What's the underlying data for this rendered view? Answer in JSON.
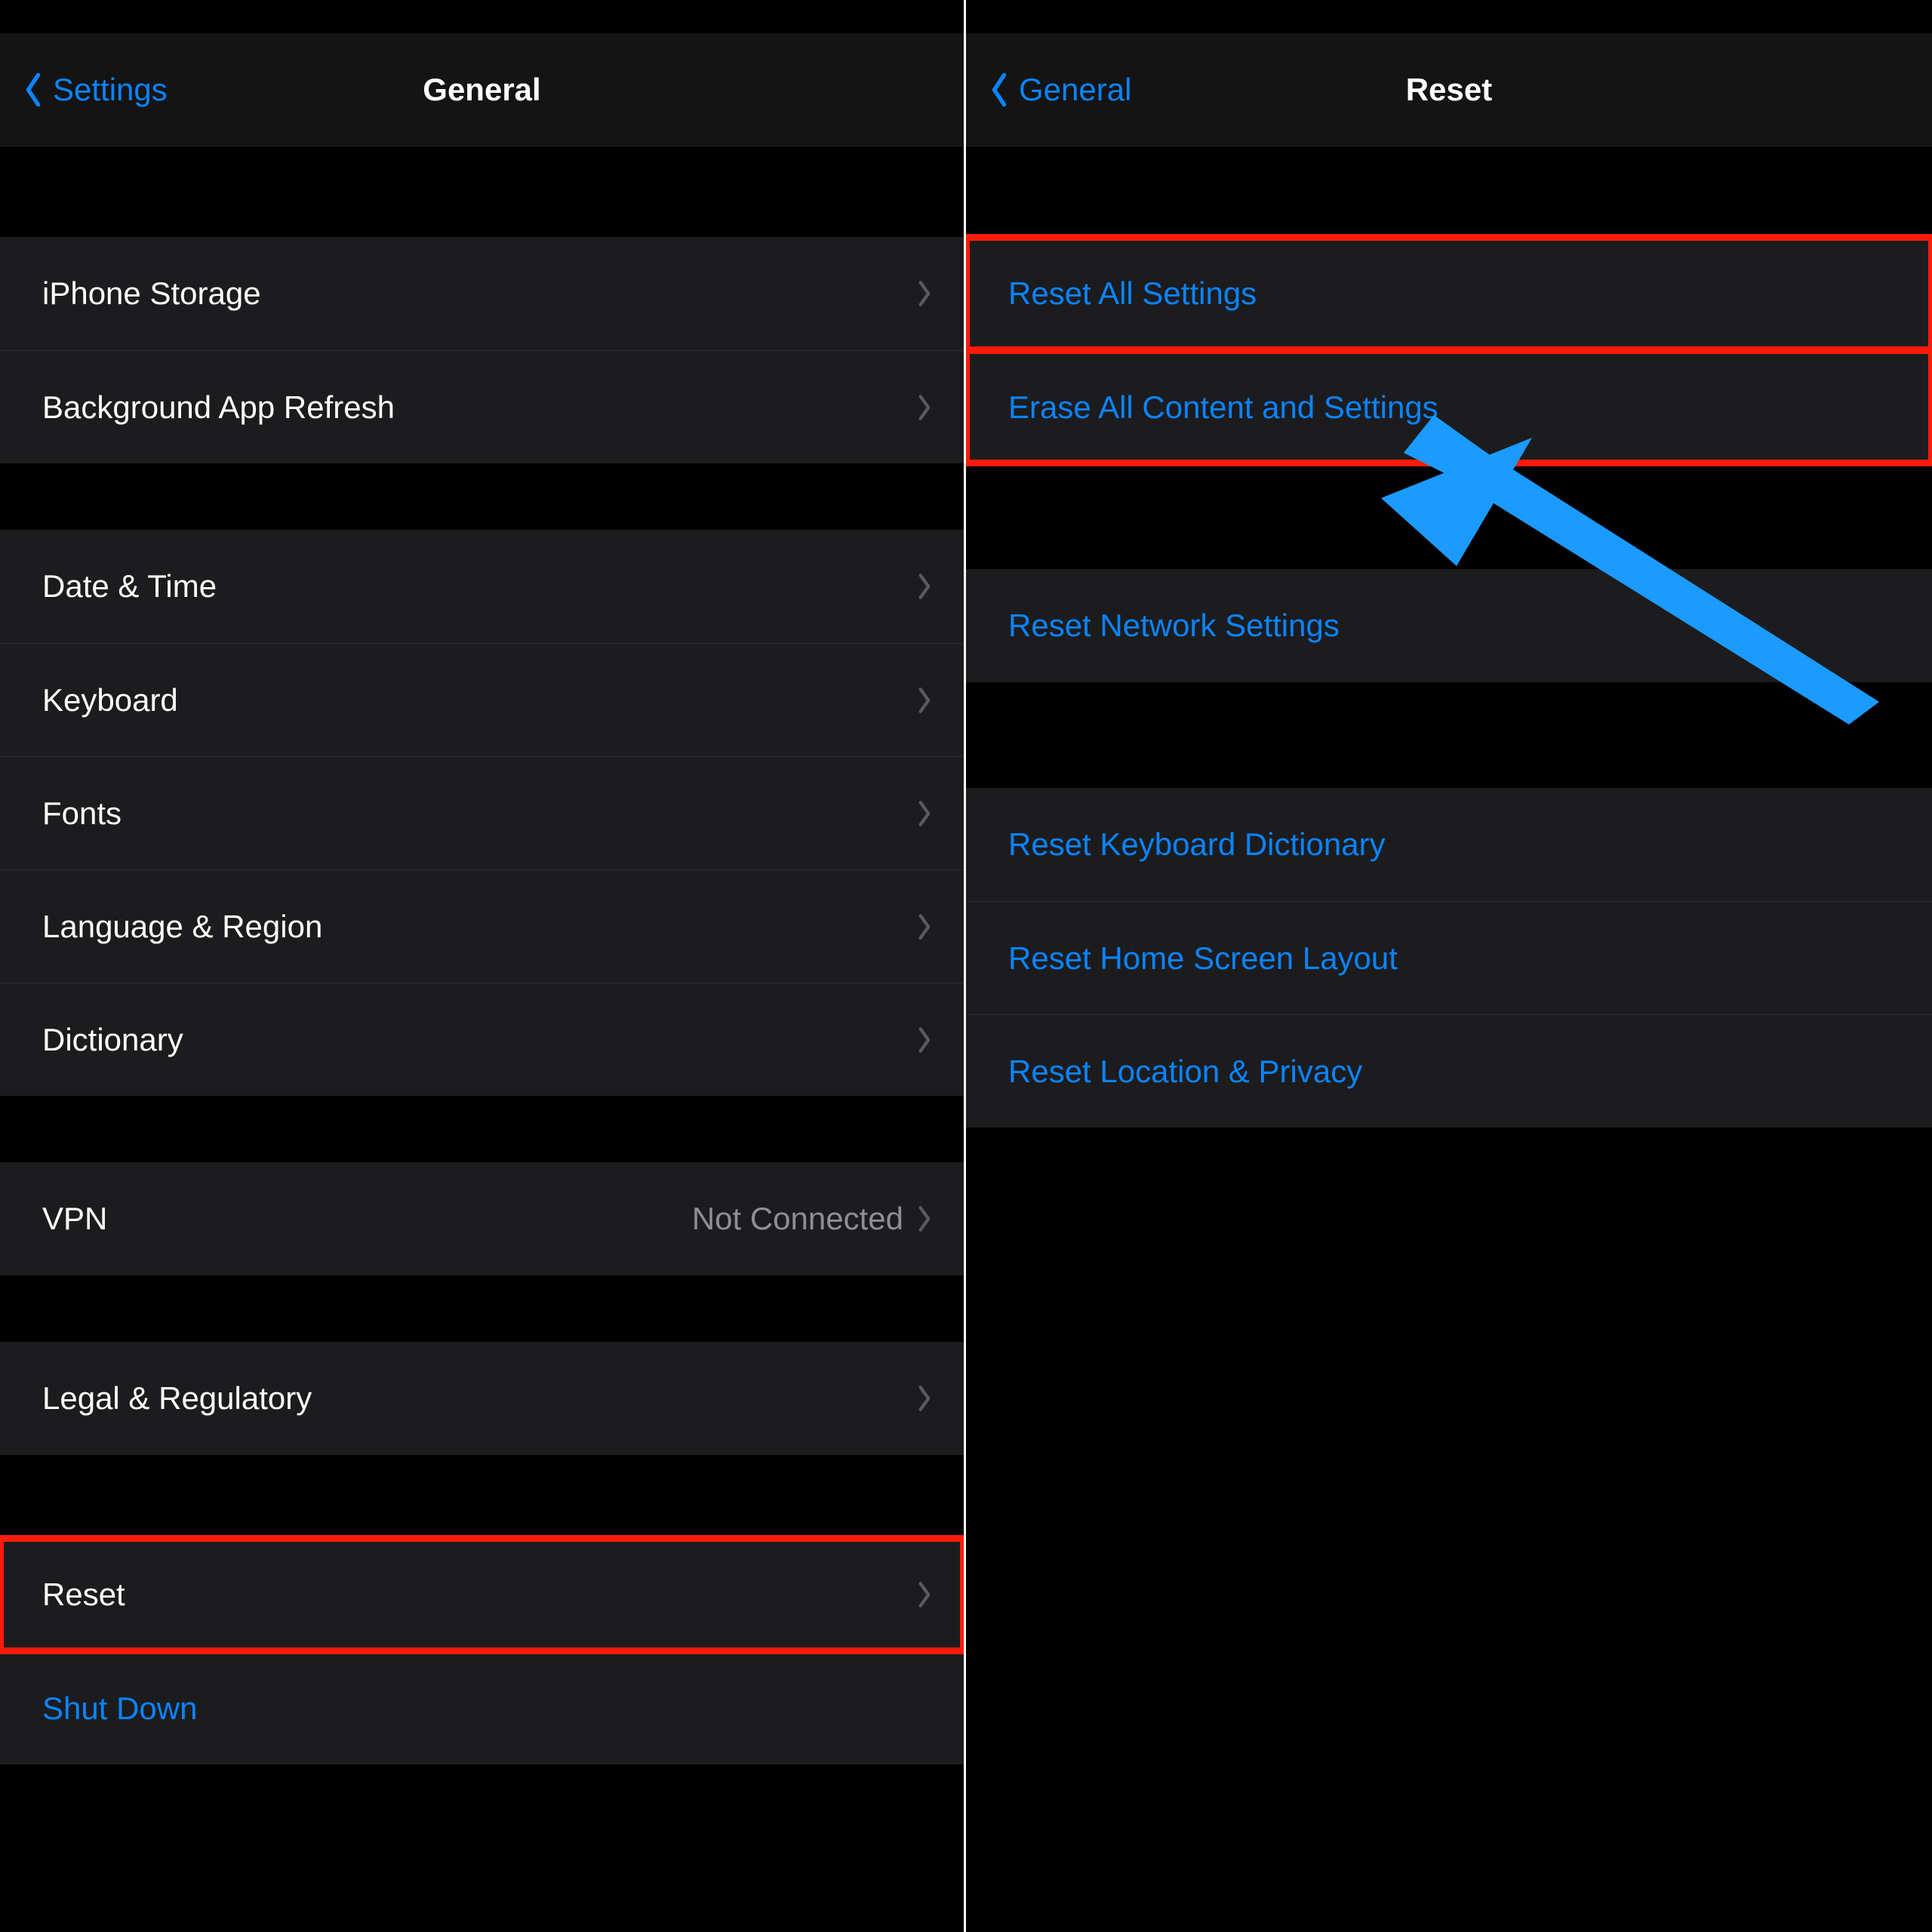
{
  "left": {
    "back_label": "Settings",
    "title": "General",
    "groups": [
      {
        "gap": "small",
        "cells": [
          {
            "label": "iPhone Storage",
            "chevron": true
          },
          {
            "label": "Background App Refresh",
            "chevron": true
          }
        ]
      },
      {
        "gap": "normal",
        "cells": [
          {
            "label": "Date & Time",
            "chevron": true
          },
          {
            "label": "Keyboard",
            "chevron": true
          },
          {
            "label": "Fonts",
            "chevron": true
          },
          {
            "label": "Language & Region",
            "chevron": true
          },
          {
            "label": "Dictionary",
            "chevron": true
          }
        ]
      },
      {
        "gap": "normal",
        "cells": [
          {
            "label": "VPN",
            "detail": "Not Connected",
            "chevron": true
          }
        ]
      },
      {
        "gap": "normal",
        "cells": [
          {
            "label": "Legal & Regulatory",
            "chevron": true
          }
        ]
      },
      {
        "gap": "normal",
        "cells": [
          {
            "label": "Reset",
            "chevron": true,
            "highlight": true
          },
          {
            "label": "Shut Down",
            "blue": true,
            "chevron": false
          }
        ]
      }
    ]
  },
  "right": {
    "back_label": "General",
    "title": "Reset",
    "groups": [
      {
        "gap": "normal",
        "cells": [
          {
            "label": "Reset All Settings",
            "blue": true,
            "highlight": true
          },
          {
            "label": "Erase All Content and Settings",
            "blue": true,
            "highlight": true,
            "arrow_target": true
          }
        ]
      },
      {
        "gap": "normal",
        "cells": [
          {
            "label": "Reset Network Settings",
            "blue": true
          }
        ]
      },
      {
        "gap": "normal",
        "cells": [
          {
            "label": "Reset Keyboard Dictionary",
            "blue": true
          },
          {
            "label": "Reset Home Screen Layout",
            "blue": true
          },
          {
            "label": "Reset Location & Privacy",
            "blue": true
          }
        ]
      }
    ]
  },
  "colors": {
    "accent": "#0a84ff",
    "highlight": "#ff1b0a",
    "cell_bg": "#1c1c1e",
    "separator": "#2c2c2e",
    "detail_text": "#8e8e93"
  }
}
